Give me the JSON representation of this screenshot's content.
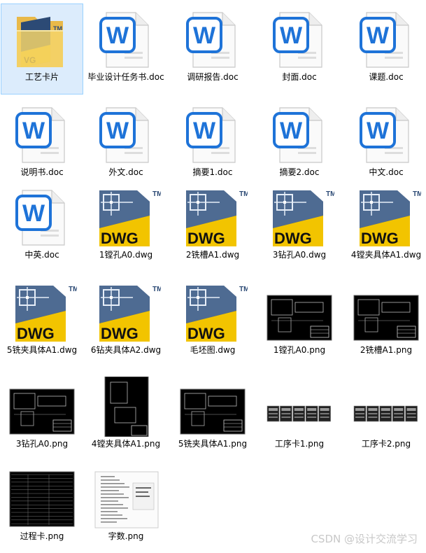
{
  "files": [
    {
      "name": "工艺卡片",
      "type": "folder",
      "selected": true
    },
    {
      "name": "毕业设计任务书.doc",
      "type": "doc"
    },
    {
      "name": "调研报告.doc",
      "type": "doc"
    },
    {
      "name": "封面.doc",
      "type": "doc"
    },
    {
      "name": "课题.doc",
      "type": "doc"
    },
    {
      "name": "说明书.doc",
      "type": "doc"
    },
    {
      "name": "外文.doc",
      "type": "doc"
    },
    {
      "name": "摘要1.doc",
      "type": "doc"
    },
    {
      "name": "摘要2.doc",
      "type": "doc"
    },
    {
      "name": "中文.doc",
      "type": "doc"
    },
    {
      "name": "中英.doc",
      "type": "doc"
    },
    {
      "name": "1镗孔A0.dwg",
      "type": "dwg"
    },
    {
      "name": "2铣槽A1.dwg",
      "type": "dwg"
    },
    {
      "name": "3钻孔A0.dwg",
      "type": "dwg"
    },
    {
      "name": "4镗夹具体A1.dwg",
      "type": "dwg"
    },
    {
      "name": "5铣夹具体A1.dwg",
      "type": "dwg"
    },
    {
      "name": "6钻夹具体A2.dwg",
      "type": "dwg"
    },
    {
      "name": "毛坯图.dwg",
      "type": "dwg"
    },
    {
      "name": "1镗孔A0.png",
      "type": "png-dark"
    },
    {
      "name": "2铣槽A1.png",
      "type": "png-dark"
    },
    {
      "name": "3钻孔A0.png",
      "type": "png-dark"
    },
    {
      "name": "4镗夹具体A1.png",
      "type": "png-tall"
    },
    {
      "name": "5铣夹具体A1.png",
      "type": "png-dark"
    },
    {
      "name": "工序卡1.png",
      "type": "png-strip"
    },
    {
      "name": "工序卡2.png",
      "type": "png-strip"
    },
    {
      "name": "过程卡.png",
      "type": "png-table"
    },
    {
      "name": "字数.png",
      "type": "png-white"
    }
  ],
  "icon_text": {
    "word_letter": "W",
    "dwg_letters": "DWG",
    "tm": "TM",
    "folder_letters": "VG"
  },
  "colors": {
    "word_blue": "#1e73d8",
    "dwg_yellow": "#f2c400",
    "dwg_navy": "#2c4a75",
    "folder_yellow": "#f5d46a",
    "selection": "#dcecfc"
  },
  "watermark": "CSDN @设计交流学习"
}
